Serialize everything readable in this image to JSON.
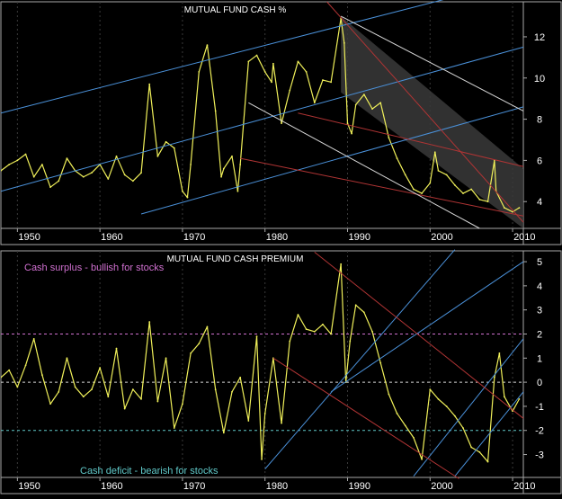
{
  "colors": {
    "background": "#000000",
    "panel_border": "#a8a8a8",
    "price_line": "#f0f05a",
    "grid": "#3a3a3a",
    "axis_text": "#ffffff",
    "blue_channel": "#4a90d8",
    "red_channel": "#b03434",
    "white_channel": "#d8d8d8",
    "shade": "#3a3a3a",
    "surplus_line": "#d070d0",
    "deficit_line": "#60c8c8"
  },
  "chart_data": [
    {
      "id": "cash",
      "type": "line",
      "title": "MUTUAL FUND CASH %",
      "xlim": [
        1948,
        2011.3
      ],
      "ylim": [
        2.7,
        13.7
      ],
      "y_ticks": [
        "4",
        "6",
        "8",
        "10",
        "12"
      ],
      "x_ticks": [
        "1950",
        "1960",
        "1970",
        "1980",
        "1990",
        "2000",
        "2010"
      ],
      "grid": true,
      "series": [
        {
          "x": [
            1948,
            1949,
            1950,
            1951,
            1952,
            1953,
            1954,
            1955,
            1956,
            1957,
            1958,
            1959,
            1960,
            1961,
            1962,
            1963,
            1964,
            1965,
            1966,
            1967,
            1968,
            1969,
            1970,
            1970.6,
            1971,
            1972,
            1973,
            1974,
            1974.7,
            1975,
            1976,
            1976.7,
            1977,
            1978,
            1979,
            1980,
            1980.8,
            1981,
            1982,
            1983,
            1984,
            1985,
            1986,
            1987,
            1988,
            1989.2,
            1989.6,
            1990,
            1990.5,
            1991,
            1992,
            1993,
            1994,
            1995,
            1996,
            1997,
            1998,
            1999,
            2000,
            2000.6,
            2001,
            2002,
            2003,
            2004,
            2005,
            2006,
            2007,
            2007.8,
            2008,
            2009,
            2010,
            2010.8
          ],
          "values": [
            5.5,
            5.8,
            6.0,
            6.3,
            5.2,
            5.8,
            4.7,
            5.0,
            6.1,
            5.5,
            5.2,
            5.4,
            5.8,
            5.1,
            6.2,
            5.3,
            5.0,
            5.4,
            9.7,
            6.2,
            6.9,
            6.6,
            4.5,
            4.2,
            5.8,
            10.3,
            11.6,
            8.4,
            5.2,
            5.6,
            6.2,
            4.5,
            5.8,
            10.8,
            11.1,
            10.3,
            9.8,
            10.7,
            7.8,
            9.4,
            10.8,
            10.3,
            8.8,
            9.9,
            9.8,
            12.9,
            11.7,
            7.8,
            7.3,
            8.7,
            9.2,
            8.5,
            8.8,
            7.1,
            6.1,
            5.3,
            4.6,
            4.4,
            4.9,
            6.4,
            5.5,
            5.3,
            4.8,
            4.4,
            4.6,
            4.1,
            4.0,
            6.0,
            4.5,
            3.7,
            3.5,
            3.7
          ]
        }
      ]
    },
    {
      "id": "premium",
      "type": "line",
      "title": "MUTUAL FUND CASH PREMIUM",
      "xlim": [
        1948,
        2011.3
      ],
      "ylim": [
        -3.95,
        5.45
      ],
      "y_ticks": [
        "5",
        "4",
        "3",
        "2",
        "1",
        "0",
        "-1",
        "-2",
        "-3"
      ],
      "x_ticks": [
        "1950",
        "1960",
        "1970",
        "1980",
        "1990",
        "2000",
        "2010"
      ],
      "grid": true,
      "surplus_level": 2,
      "zero_level": 0,
      "deficit_level": -2,
      "annotations": {
        "surplus": "Cash surplus - bullish for stocks",
        "deficit": "Cash deficit - bearish for stocks"
      },
      "series": [
        {
          "x": [
            1948,
            1949,
            1950,
            1951,
            1952,
            1953,
            1954,
            1955,
            1956,
            1957,
            1958,
            1959,
            1960,
            1961,
            1962,
            1963,
            1964,
            1965,
            1966,
            1967,
            1968,
            1969,
            1970,
            1971,
            1972,
            1973,
            1974,
            1975,
            1976,
            1977,
            1978,
            1979,
            1979.6,
            1980,
            1981,
            1982,
            1983,
            1984,
            1985,
            1986,
            1987,
            1988,
            1989.2,
            1989.8,
            1990.3,
            1991,
            1992,
            1993,
            1994,
            1995,
            1996,
            1997,
            1998,
            1999,
            2000,
            2001,
            2002,
            2003,
            2004,
            2005,
            2006,
            2007,
            2007.8,
            2008.4,
            2009,
            2010,
            2010.8
          ],
          "values": [
            0.2,
            0.5,
            -0.2,
            0.7,
            1.8,
            0.3,
            -0.9,
            -0.4,
            1.0,
            -0.2,
            -0.6,
            -0.3,
            0.6,
            -0.6,
            1.4,
            -1.1,
            -0.3,
            -0.7,
            2.5,
            -0.8,
            1.0,
            -1.9,
            -0.9,
            1.2,
            1.6,
            2.3,
            -0.3,
            -2.1,
            -0.4,
            0.2,
            -1.6,
            1.9,
            -3.2,
            -1.3,
            1.0,
            -1.7,
            1.7,
            2.8,
            2.2,
            2.1,
            2.4,
            2.0,
            4.9,
            0.0,
            1.7,
            3.2,
            2.9,
            2.1,
            0.8,
            -0.5,
            -1.3,
            -1.8,
            -2.3,
            -3.2,
            -0.3,
            -0.7,
            -1.0,
            -1.4,
            -1.9,
            -2.7,
            -2.9,
            -3.3,
            0.2,
            1.2,
            -0.6,
            -1.2,
            -0.7
          ]
        }
      ]
    }
  ]
}
